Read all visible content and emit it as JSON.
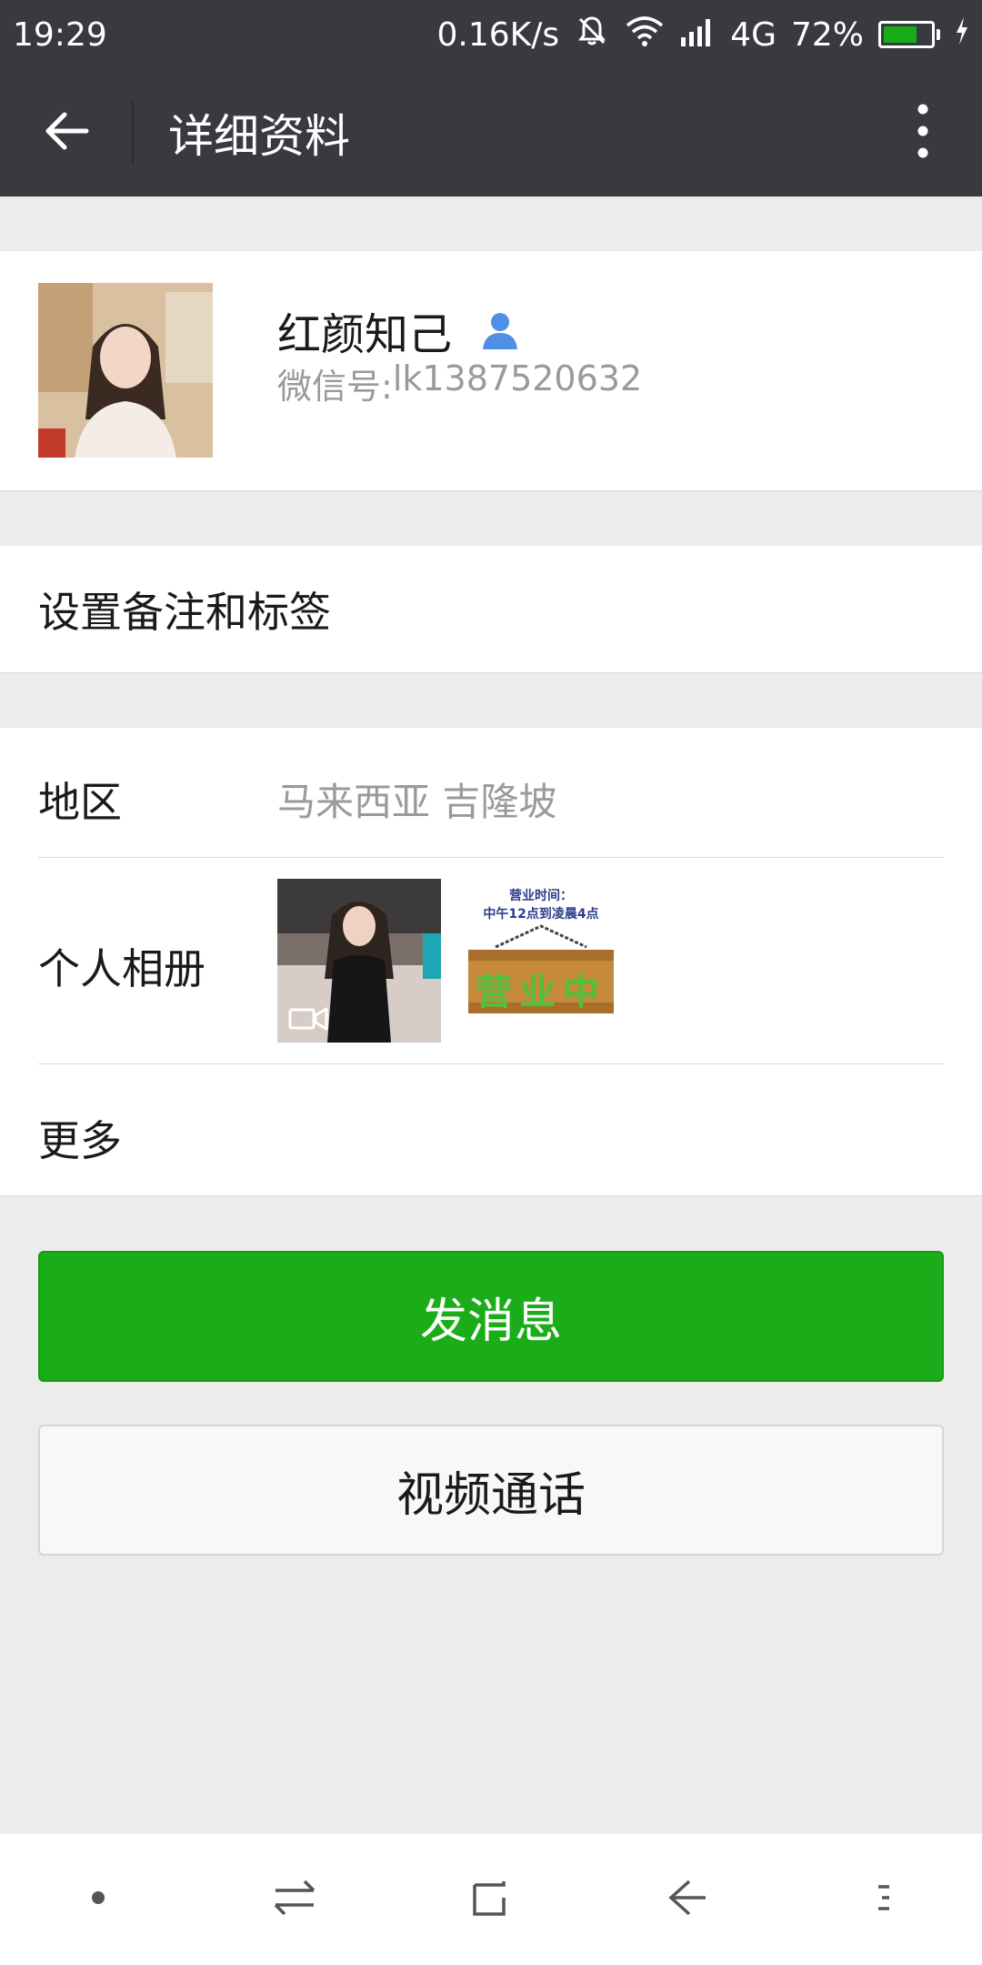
{
  "status_bar": {
    "time": "19:29",
    "network_speed": "0.16K/s",
    "network_type": "4G",
    "battery_percent": "72%",
    "battery_level": 0.72,
    "icons": [
      "bell-off-icon",
      "wifi-icon",
      "signal-icon",
      "battery-icon",
      "charging-icon"
    ]
  },
  "nav": {
    "title": "详细资料",
    "back_icon": "arrow-left-icon",
    "more_icon": "more-vertical-icon"
  },
  "profile": {
    "name": "红颜知己",
    "id_label": "微信号: ",
    "id_value": "lk1387520632",
    "gender_icon": "person-icon"
  },
  "remark": {
    "label": "设置备注和标签"
  },
  "info": {
    "region_label": "地区",
    "region_value": "马来西亚  吉隆坡",
    "album_label": "个人相册",
    "album_sign": {
      "line1": "营业时间：",
      "line2": "中午12点到凌晨4点",
      "board_text": "营业中"
    },
    "more_label": "更多"
  },
  "actions": {
    "send_message": "发消息",
    "video_call": "视频通话"
  },
  "colors": {
    "header_bg": "#393a3f",
    "primary_green": "#1aad19",
    "page_bg": "#ececec"
  }
}
